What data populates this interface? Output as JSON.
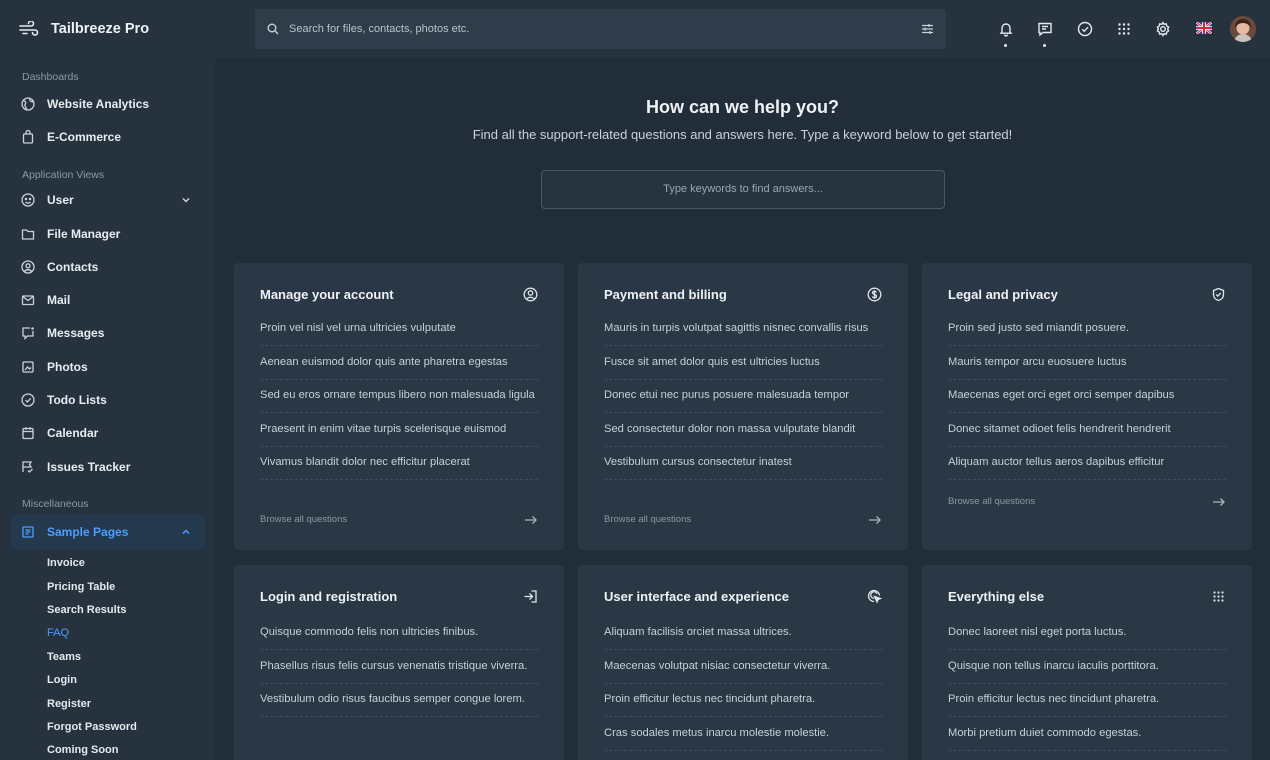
{
  "brand": {
    "name": "Tailbreeze Pro"
  },
  "sidebar": {
    "groups": [
      {
        "title": "Dashboards",
        "items": [
          {
            "label": "Website Analytics",
            "icon": "globe-icon"
          },
          {
            "label": "E-Commerce",
            "icon": "bag-icon"
          }
        ]
      },
      {
        "title": "Application Views",
        "items": [
          {
            "label": "User",
            "icon": "user-circle-icon"
          },
          {
            "label": "File Manager",
            "icon": "folder-icon"
          },
          {
            "label": "Contacts",
            "icon": "contact-icon"
          },
          {
            "label": "Mail",
            "icon": "mail-icon"
          },
          {
            "label": "Messages",
            "icon": "message-icon"
          },
          {
            "label": "Photos",
            "icon": "photo-icon"
          },
          {
            "label": "Todo Lists",
            "icon": "check-circle-icon"
          },
          {
            "label": "Calendar",
            "icon": "calendar-icon"
          },
          {
            "label": "Issues Tracker",
            "icon": "issues-icon"
          }
        ]
      },
      {
        "title": "Miscellaneous",
        "items": [
          {
            "label": "Sample Pages",
            "icon": "pages-icon"
          }
        ]
      }
    ],
    "sub_items": [
      "Invoice",
      "Pricing Table",
      "Search Results",
      "FAQ",
      "Teams",
      "Login",
      "Register",
      "Forgot Password",
      "Coming Soon"
    ]
  },
  "topbar": {
    "search_placeholder": "Search for files, contacts, photos etc."
  },
  "hero": {
    "title": "How can we help you?",
    "subtitle": "Find all the support-related questions and answers here. Type a keyword below to get started!",
    "search_placeholder": "Type keywords to find answers..."
  },
  "cards": [
    {
      "title": "Manage your account",
      "icon": "user-circle-icon",
      "browse": "Browse all questions",
      "questions": [
        "Proin vel nisl vel urna ultricies vulputate",
        "Aenean euismod dolor quis ante pharetra egestas",
        "Sed eu eros ornare tempus libero non malesuada ligula",
        "Praesent in enim vitae turpis scelerisque euismod",
        "Vivamus blandit dolor nec efficitur placerat"
      ]
    },
    {
      "title": "Payment and billing",
      "icon": "dollar-icon",
      "browse": "Browse all questions",
      "questions": [
        "Mauris in turpis volutpat sagittis nisnec convallis risus",
        "Fusce sit amet dolor quis est ultricies luctus",
        "Donec etui nec purus posuere malesuada tempor",
        "Sed consectetur dolor non massa vulputate blandit",
        "Vestibulum cursus consectetur inatest"
      ]
    },
    {
      "title": "Legal and privacy",
      "icon": "shield-icon",
      "browse": "Browse all questions",
      "questions": [
        "Proin sed justo sed miandit posuere.",
        "Mauris tempor arcu euosuere luctus",
        "Maecenas eget orci eget orci semper dapibus",
        "Donec sitamet odioet felis hendrerit hendrerit",
        "Aliquam auctor tellus aeros dapibus efficitur"
      ]
    },
    {
      "title": "Login and registration",
      "icon": "login-icon",
      "browse": "",
      "questions": [
        "Quisque commodo felis non ultricies finibus.",
        "Phasellus risus felis cursus venenatis tristique viverra.",
        "Vestibulum odio risus faucibus semper congue lorem."
      ]
    },
    {
      "title": "User interface and experience",
      "icon": "cursor-click-icon",
      "browse": "",
      "questions": [
        "Aliquam facilisis orciet massa ultrices.",
        "Maecenas volutpat nisiac consectetur viverra.",
        "Proin efficitur lectus nec tincidunt pharetra.",
        "Cras sodales metus inarcu molestie molestie."
      ]
    },
    {
      "title": "Everything else",
      "icon": "grid-icon",
      "browse": "",
      "questions": [
        "Donec laoreet nisl eget porta luctus.",
        "Quisque non tellus inarcu iaculis porttitora.",
        "Proin efficitur lectus nec tincidunt pharetra.",
        "Morbi pretium duiet commodo egestas."
      ]
    }
  ]
}
